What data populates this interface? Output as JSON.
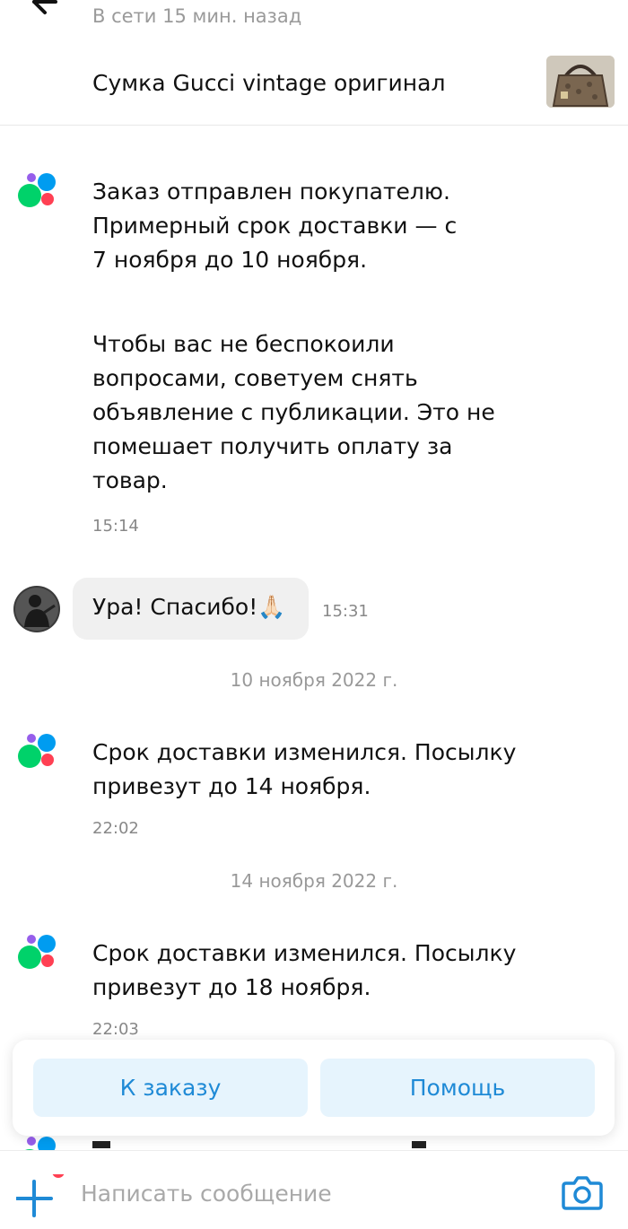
{
  "header": {
    "status": "В сети 15 мин. назад"
  },
  "listing": {
    "title": "Сумка Gucci vintage оригинал"
  },
  "messages": {
    "m1": {
      "p1": "Заказ отправлен покупателю. Примерный срок доставки — с 7 ноября до 10 ноября.",
      "p2": "Чтобы вас не беспокоили вопросами, советуем снять объявление с публикации. Это не помешает получить оплату за товар.",
      "time": "15:14"
    },
    "m2": {
      "text": "Ура! Спасибо!🙏🏻",
      "time": "15:31"
    },
    "date1": "10 ноября 2022 г.",
    "m3": {
      "text": "Срок доставки изменился. Посылку привезут до 14 ноября.",
      "time": "22:02"
    },
    "date2": "14 ноября 2022 г.",
    "m4": {
      "text": "Срок доставки изменился. Посылку привезут до 18 ноября.",
      "time": "22:03"
    }
  },
  "actions": {
    "order": "К заказу",
    "help": "Помощь"
  },
  "composer": {
    "placeholder": "Написать сообщение"
  },
  "colors": {
    "accent_blue": "#1f8ad6",
    "button_bg": "#e6f4fd",
    "logo_green": "#00d26a",
    "logo_blue": "#009cf0",
    "logo_red": "#ff4053",
    "logo_purple": "#965eeb"
  },
  "icons": [
    "back-arrow-icon",
    "avito-logo-icon",
    "plus-icon",
    "camera-icon",
    "notification-dot-icon"
  ]
}
